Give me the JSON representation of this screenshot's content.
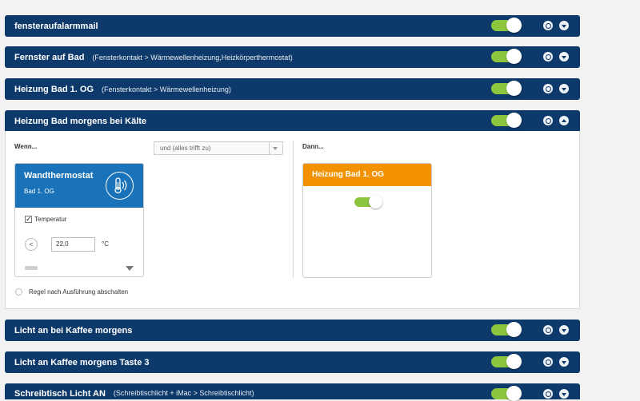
{
  "rules": [
    {
      "name": "fensteraufalarmmail",
      "desc": ""
    },
    {
      "name": "Fernster auf Bad",
      "desc": "(Fensterkontakt > Wärmewellenheizung,Heizkörperthermostat)"
    },
    {
      "name": "Heizung Bad 1. OG",
      "desc": "(Fensterkontakt > Wärmewellenheizung)"
    },
    {
      "name": "Heizung Bad morgens bei Kälte",
      "desc": ""
    },
    {
      "name": "Licht an bei Kaffee morgens",
      "desc": ""
    },
    {
      "name": "Licht an Kaffee morgens Taste 3",
      "desc": ""
    },
    {
      "name": "Schreibtisch Licht AN",
      "desc": "(Schreibtischlicht + iMac > Schreibtischlicht)"
    }
  ],
  "expanded": {
    "wenn_label": "Wenn...",
    "dann_label": "Dann...",
    "logic_select_value": "und (alles trifft zu)",
    "condition_card": {
      "title": "Wandthermostat",
      "subtitle": "Bad 1. OG",
      "checkbox_label": "Temperatur",
      "operator": "<",
      "value": "22,0",
      "unit": "°C"
    },
    "action_card": {
      "title": "Heizung Bad 1. OG"
    },
    "disable_after_label": "Regel nach Ausführung abschalten"
  },
  "colors": {
    "bar": "#0e3a6b",
    "toggle_on": "#8cc63e",
    "condition_header": "#1a73b8",
    "action_header": "#f39200"
  },
  "icons": {
    "thermostat": "thermostat-icon",
    "gear": "gear-icon",
    "chevron": "chevron-icon"
  }
}
